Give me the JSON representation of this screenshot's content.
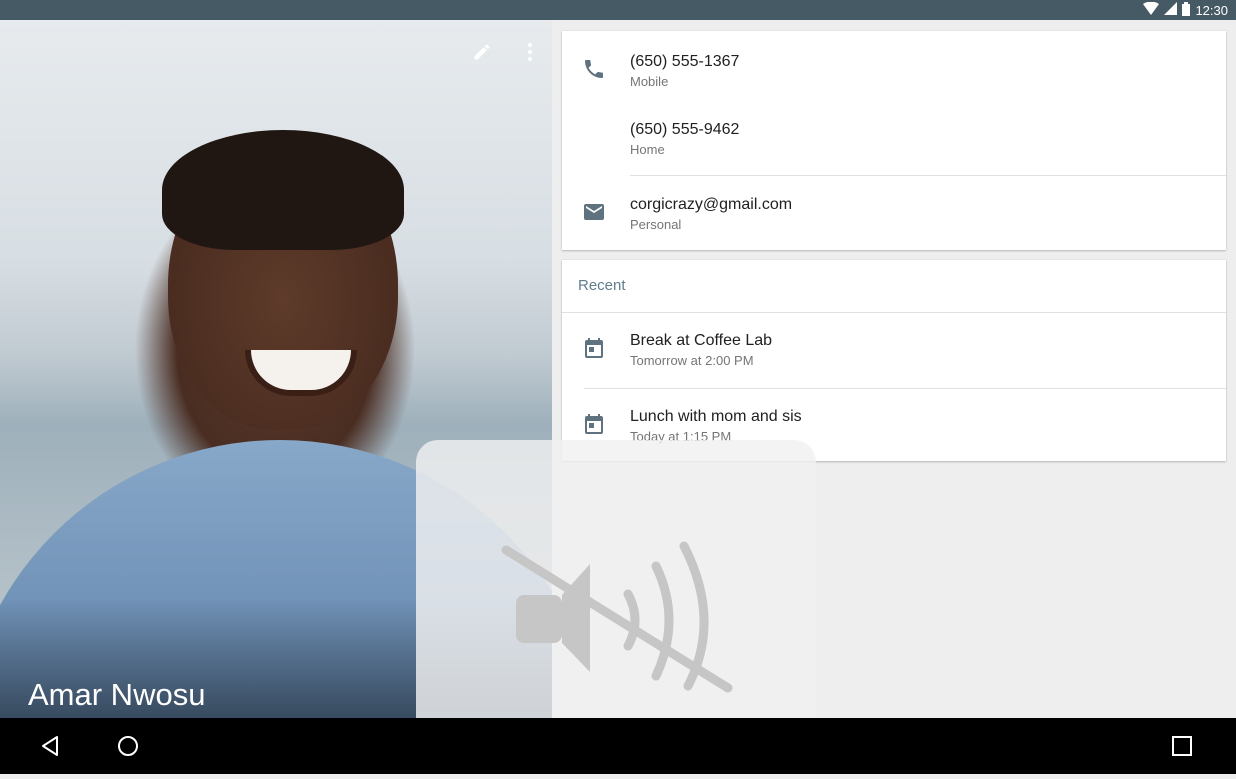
{
  "status_bar": {
    "time": "12:30",
    "icons": [
      "wifi-icon",
      "cell-signal-icon",
      "battery-icon"
    ]
  },
  "contact": {
    "name": "Amar Nwosu",
    "actions": [
      "edit-icon",
      "more-vert-icon"
    ]
  },
  "details": {
    "phones": [
      {
        "number": "(650) 555-1367",
        "type": "Mobile"
      },
      {
        "number": "(650) 555-9462",
        "type": "Home"
      }
    ],
    "email": {
      "address": "corgicrazy@gmail.com",
      "type": "Personal"
    }
  },
  "recent": {
    "title": "Recent",
    "items": [
      {
        "title": "Break at Coffee Lab",
        "time": "Tomorrow at 2:00 PM",
        "icon": "calendar-icon"
      },
      {
        "title": "Lunch with mom and sis",
        "time": "Today at 1:15 PM",
        "icon": "calendar-icon"
      }
    ]
  },
  "overlay": {
    "icon": "volume-off-icon"
  },
  "nav_bar": {
    "buttons": [
      "back-icon",
      "home-icon",
      "recents-icon"
    ]
  },
  "colors": {
    "status_bar": "#455a64",
    "accent_text": "#607d8b",
    "icon_grey": "#5f7280"
  }
}
